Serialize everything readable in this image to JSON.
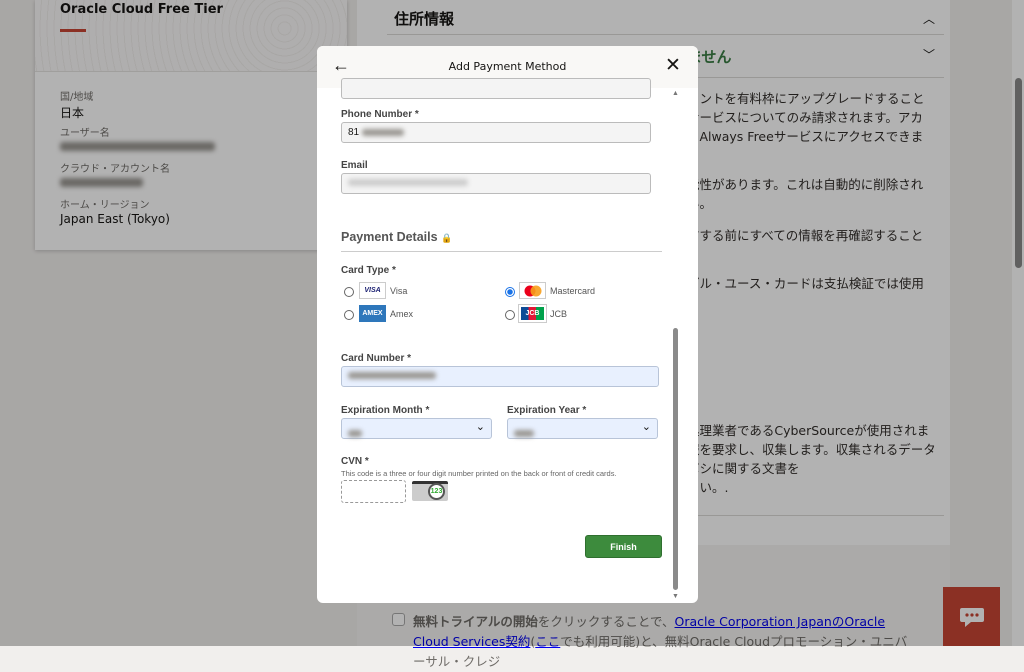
{
  "left_card": {
    "title": "Oracle Cloud Free Tier",
    "fields": [
      {
        "label": "国/地域",
        "value": "日本"
      },
      {
        "label": "ユーザー名",
        "value": ""
      },
      {
        "label": "クラウド・アカウント名",
        "value": ""
      },
      {
        "label": "ホーム・リージョン",
        "value": "Japan East (Tokyo)"
      }
    ]
  },
  "right": {
    "address_title": "住所情報",
    "payment_title_partial": "ません",
    "para1": [
      "ウントを有料枠にアップグレードすること",
      "サービスについてのみ請求されます。アカ",
      "きAlways Freeサービスにアクセスできま"
    ],
    "para2": [
      "能性があります。これは自動的に削除され",
      "い。"
    ],
    "para3": [
      "信する前にすべての情報を再確認すること"
    ],
    "para4": [
      "ブル・ユース・カードは支払検証では使用"
    ],
    "para5": [
      "処理業者であるCyberSourceが使用されま",
      "報を要求し、収集します。収集されるデータ",
      "ボシに関する文書を",
      "さい。."
    ],
    "terms": {
      "bold": "無料トライアルの開始",
      "text1": "をクリックすることで、",
      "link1": "Oracle Corporation JapanのOracle Cloud Services契約",
      "paren_open": "(",
      "link2": "ここ",
      "text2": "でも利用可能)と、無料Oracle Cloudプロモーション・ユニバーサル・クレジ"
    }
  },
  "modal": {
    "title": "Add Payment Method",
    "phone": {
      "label": "Phone Number *",
      "value": "81"
    },
    "email": {
      "label": "Email"
    },
    "payment_details": "Payment Details",
    "card_type": {
      "label": "Card Type *",
      "options": [
        {
          "name": "Visa",
          "logo": "VISA",
          "selected": false
        },
        {
          "name": "Mastercard",
          "selected": true
        },
        {
          "name": "Amex",
          "logo": "AMEX",
          "selected": false
        },
        {
          "name": "JCB",
          "logo": "JCB",
          "selected": false
        }
      ]
    },
    "card_number": {
      "label": "Card Number *"
    },
    "exp_month": {
      "label": "Expiration Month *"
    },
    "exp_year": {
      "label": "Expiration Year *"
    },
    "cvn": {
      "label": "CVN *",
      "help": "This code is a three or four digit number printed on the back or front of credit cards.",
      "icon_text": "123"
    },
    "finish": "Finish"
  },
  "colors": {
    "accent": "#c74634",
    "finish": "#3d8b3d",
    "green_title": "#3a7d44"
  }
}
